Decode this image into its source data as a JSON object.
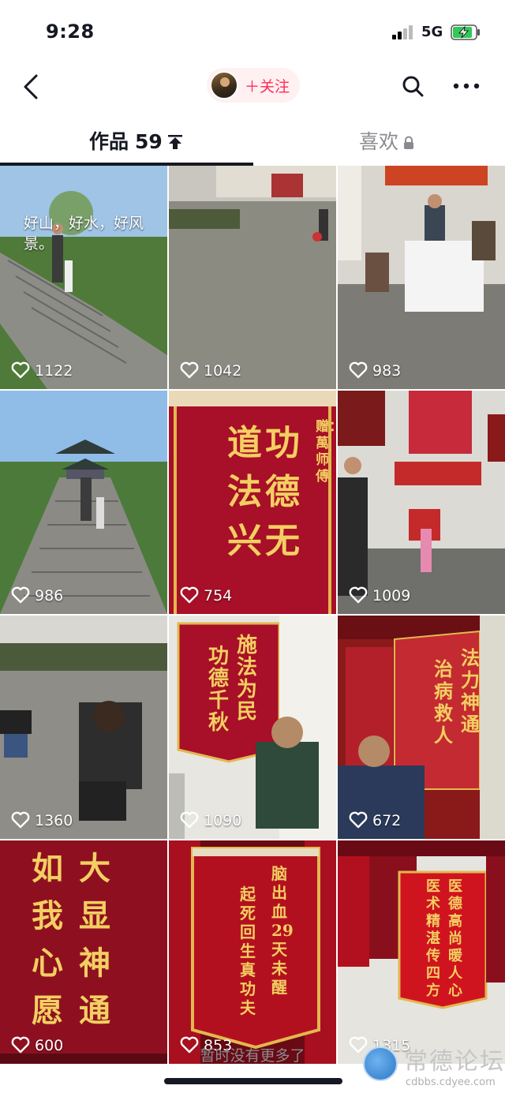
{
  "status_bar": {
    "time": "9:28",
    "network": "5G"
  },
  "nav": {
    "follow_label": "＋关注"
  },
  "tabs": {
    "works_label": "作品",
    "works_count": "59",
    "likes_label": "喜欢"
  },
  "videos": [
    {
      "likes": "1122",
      "caption": "好山，好水，好风景。"
    },
    {
      "likes": "1042"
    },
    {
      "likes": "983"
    },
    {
      "likes": "986"
    },
    {
      "likes": "754",
      "banner": [
        "功",
        "道",
        "德",
        "法",
        "无",
        "兴"
      ],
      "donor": "赠：萬师傅"
    },
    {
      "likes": "1009"
    },
    {
      "likes": "1360"
    },
    {
      "likes": "1090",
      "banner": [
        "施法为民",
        "功德千秋"
      ]
    },
    {
      "likes": "672",
      "banner": [
        "法力神通",
        "治病救人"
      ]
    },
    {
      "likes": "600",
      "banner": [
        "大显神通",
        "如我心愿"
      ]
    },
    {
      "likes": "853",
      "banner": [
        "脑出血29天未醒",
        "起死回生真功夫"
      ]
    },
    {
      "likes": "1315",
      "banner": [
        "医德高尚暖人心",
        "医术精湛传四方"
      ]
    }
  ],
  "footer": {
    "no_more": "暂时没有更多了"
  },
  "watermark": {
    "title": "常德论坛",
    "url": "cdbbs.cdyee.com"
  },
  "colors": {
    "accent": "#fe2c55",
    "text": "#161823",
    "muted": "#8a8b91",
    "banner_red": "#b0102a",
    "banner_gold": "#f3cf62"
  }
}
